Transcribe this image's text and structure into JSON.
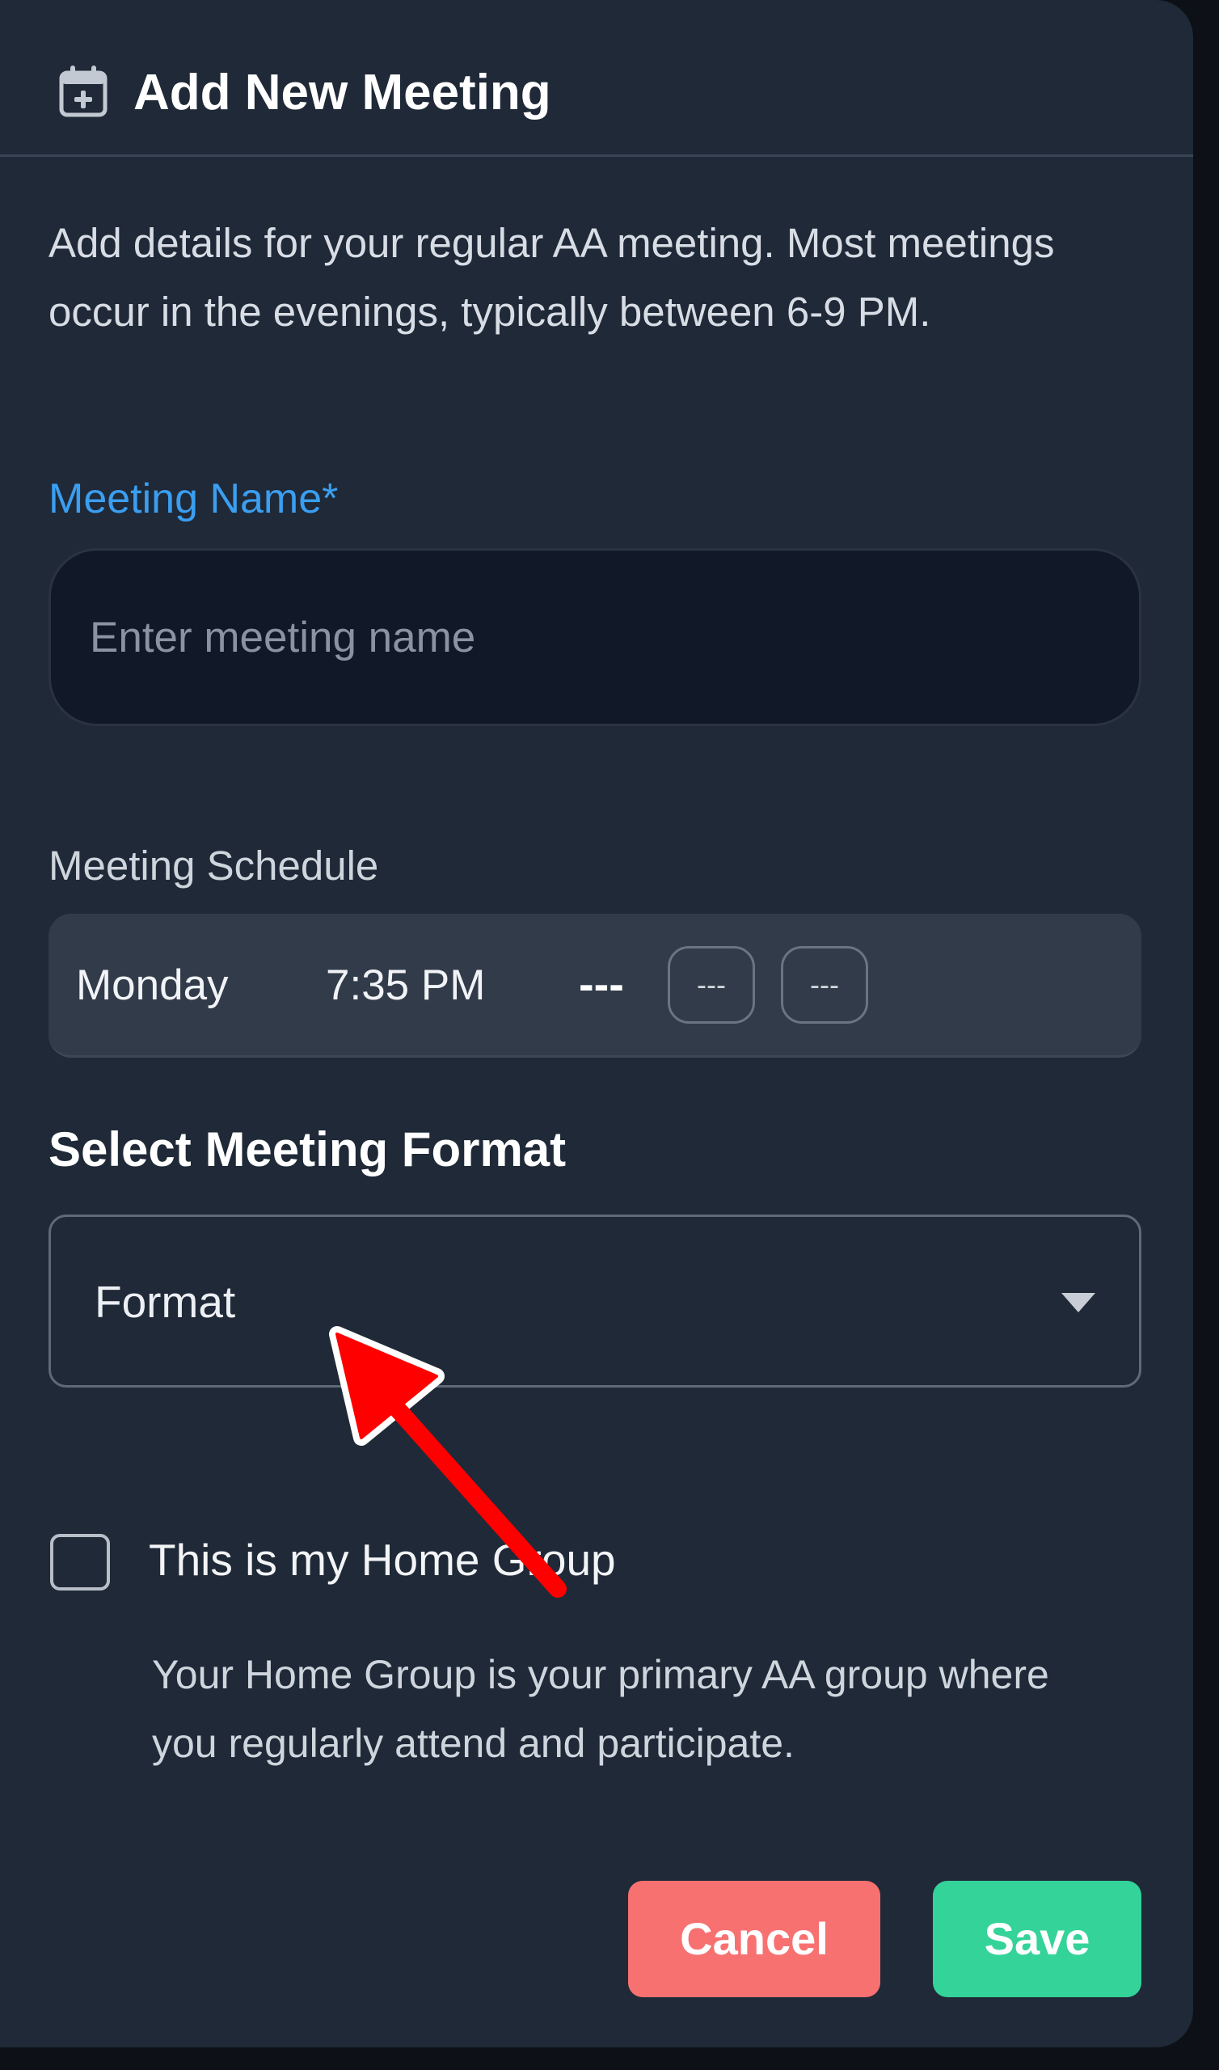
{
  "dialog": {
    "title": "Add New Meeting",
    "description": "Add details for your regular AA meeting. Most meetings occur in the evenings, typically between 6-9 PM."
  },
  "meeting_name": {
    "label": "Meeting Name*",
    "placeholder": "Enter meeting name",
    "value": ""
  },
  "schedule": {
    "label": "Meeting Schedule",
    "day": "Monday",
    "time": "7:35 PM",
    "dashes": "---",
    "option_1": "---",
    "option_2": "---"
  },
  "format": {
    "title": "Select Meeting Format",
    "selected": "Format"
  },
  "home_group": {
    "checked": false,
    "label": "This is my Home Group",
    "description": "Your Home Group is your primary AA group where you regularly attend and participate."
  },
  "actions": {
    "cancel_label": "Cancel",
    "save_label": "Save"
  },
  "colors": {
    "panel_bg": "#1f2937",
    "input_bg": "#111827",
    "label_accent": "#3b9ef0",
    "cancel": "#f87171",
    "save": "#34d399",
    "annotation_arrow": "#ff0000"
  },
  "icons": {
    "header": "calendar-plus-icon",
    "select": "caret-down-icon",
    "annotation": "red-arrow-pointer"
  }
}
